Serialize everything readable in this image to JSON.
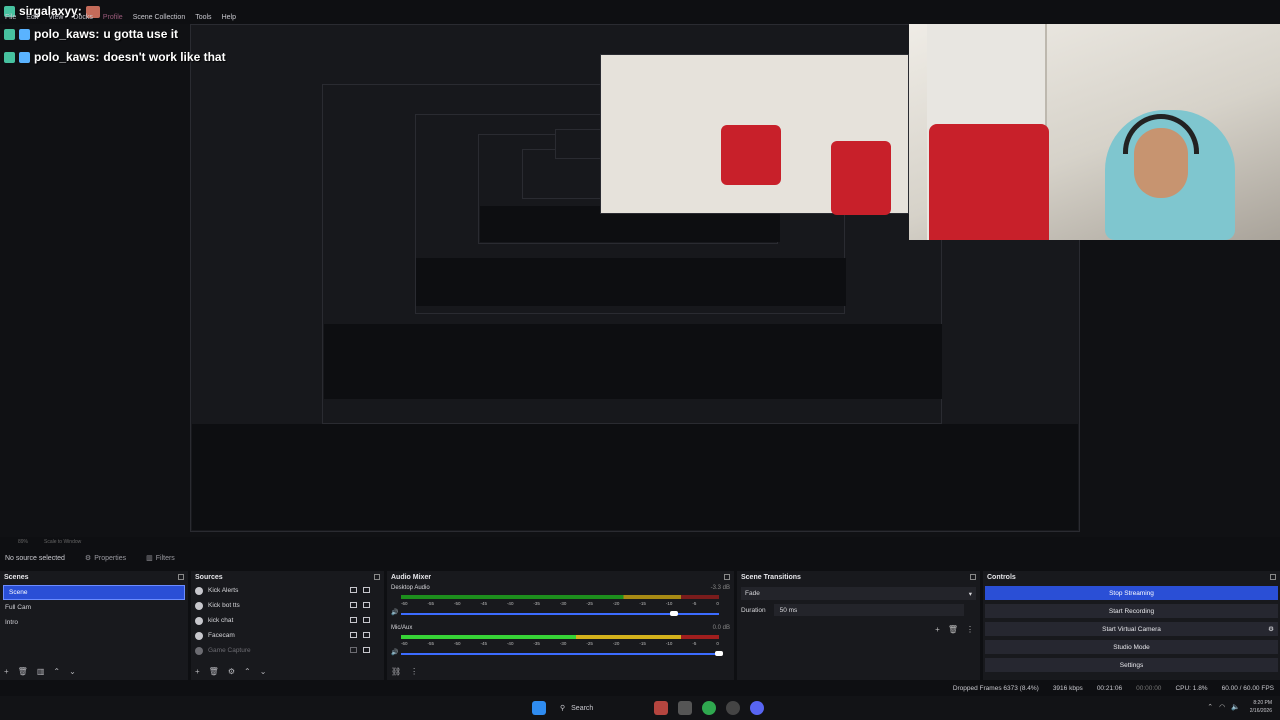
{
  "menu": {
    "items": [
      "File",
      "Edit",
      "View",
      "Docks",
      "Profile",
      "Scene Collection",
      "Tools",
      "Help"
    ]
  },
  "chat": {
    "messages": [
      {
        "user": "sirgalaxyy:",
        "text": ""
      },
      {
        "user": "polo_kaws:",
        "text": "u gotta use it"
      },
      {
        "user": "polo_kaws:",
        "text": "doesn't work like that"
      }
    ]
  },
  "canvas": {
    "zoom": "89%",
    "mode": "Scale to Window"
  },
  "source_toolbar": {
    "no_source": "No source selected",
    "properties": "Properties",
    "filters": "Filters"
  },
  "scenes": {
    "title": "Scenes",
    "items": [
      "Scene",
      "Full Cam",
      "Intro"
    ],
    "selected": 0
  },
  "sources": {
    "title": "Sources",
    "items": [
      "Kick Alerts",
      "Kick bot tts",
      "kick chat",
      "Facecam",
      "Game Capture"
    ]
  },
  "mixer": {
    "title": "Audio Mixer",
    "channels": [
      {
        "name": "Desktop Audio",
        "db": "-3.3 dB"
      },
      {
        "name": "Mic/Aux",
        "db": "0.0 dB"
      }
    ],
    "ticks": [
      "-60",
      "-55",
      "-50",
      "-45",
      "-40",
      "-35",
      "-30",
      "-25",
      "-20",
      "-15",
      "-10",
      "-5",
      "0"
    ]
  },
  "transitions": {
    "title": "Scene Transitions",
    "type": "Fade",
    "duration_label": "Duration",
    "duration_value": "50 ms"
  },
  "controls": {
    "title": "Controls",
    "buttons": [
      "Stop Streaming",
      "Start Recording",
      "Start Virtual Camera",
      "Studio Mode",
      "Settings"
    ]
  },
  "status": {
    "dropped": "Dropped Frames 6373 (8.4%)",
    "bitrate": "3916 kbps",
    "stream_time": "00:21:06",
    "rec_time": "00:00:00",
    "cpu": "CPU: 1.8%",
    "fps": "60.00 / 60.00 FPS"
  },
  "taskbar": {
    "search": "Search",
    "time": "8:20 PM",
    "date": "2/16/2026"
  }
}
